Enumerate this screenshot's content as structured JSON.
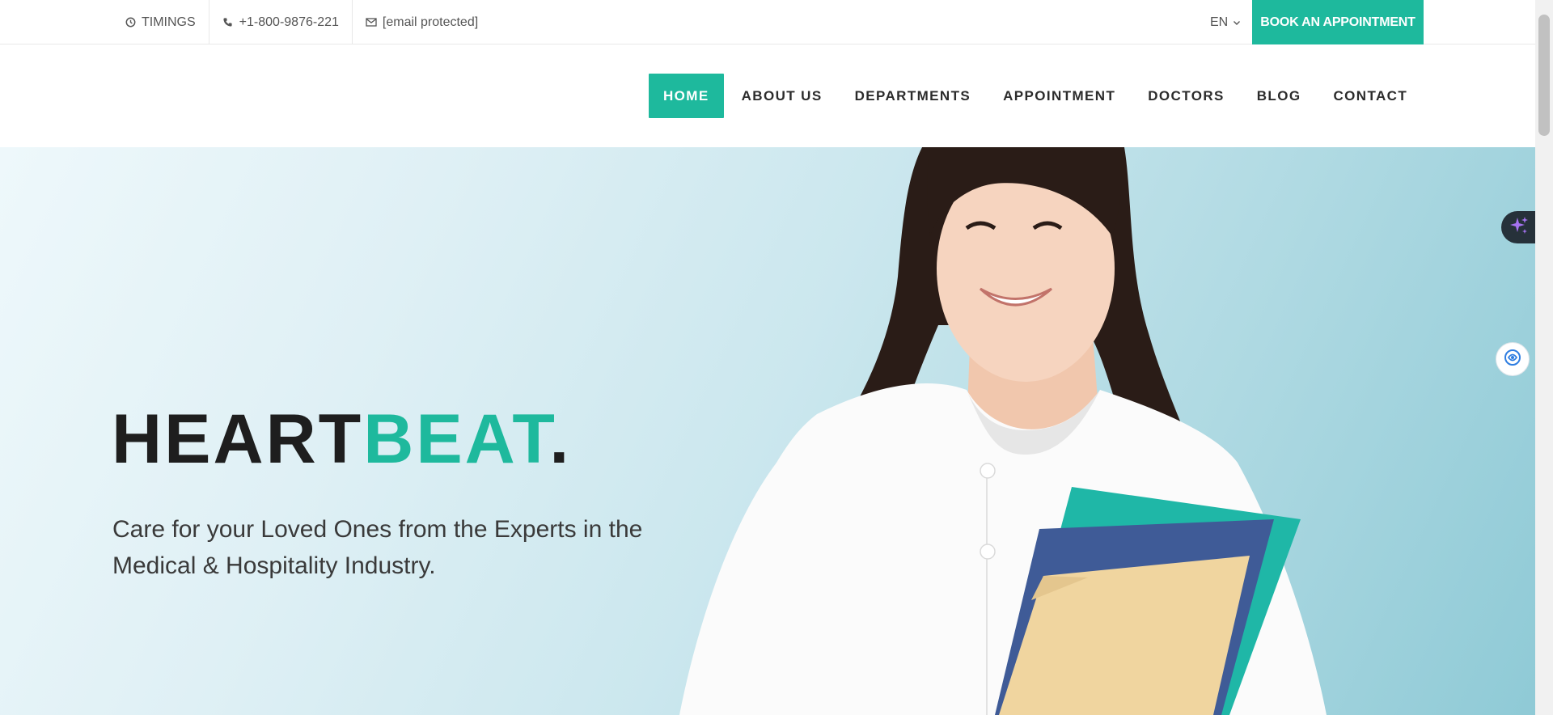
{
  "topbar": {
    "timings": "TIMINGS",
    "phone": "+1-800-9876-221",
    "email": "[email protected]",
    "language": "EN",
    "book_button": "BOOK AN APPOINTMENT"
  },
  "nav": {
    "items": [
      {
        "label": "HOME",
        "active": true
      },
      {
        "label": "ABOUT US"
      },
      {
        "label": "DEPARTMENTS"
      },
      {
        "label": "APPOINTMENT"
      },
      {
        "label": "DOCTORS"
      },
      {
        "label": "BLOG"
      },
      {
        "label": "CONTACT"
      }
    ]
  },
  "hero": {
    "title_dark": "HEART",
    "title_accent": "BEAT",
    "title_dot": ".",
    "subtitle": "Care for your Loved Ones from the Experts in the Medical & Hospitality Industry."
  },
  "icons": {
    "timings": "clock-icon",
    "phone": "phone-icon",
    "email": "envelope-icon",
    "language": "chevron-down-icon",
    "ai": "sparkle-icon",
    "chat": "chat-assistant-icon"
  },
  "colors": {
    "accent": "#1eb99d",
    "dark_text": "#1e1e1e"
  }
}
